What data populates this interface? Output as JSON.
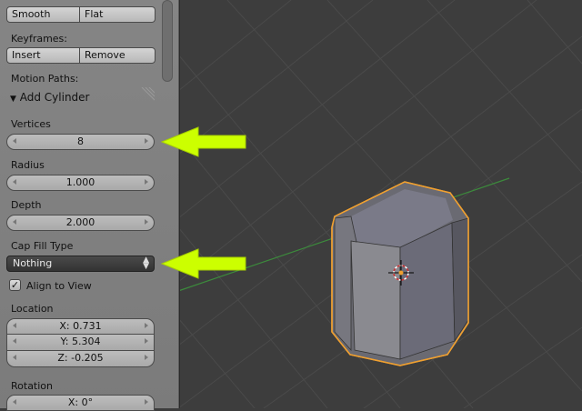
{
  "panel": {
    "shading": {
      "smooth_label": "Smooth",
      "flat_label": "Flat"
    },
    "keyframes": {
      "label": "Keyframes:",
      "insert_label": "Insert",
      "remove_label": "Remove"
    },
    "motion_paths_label": "Motion Paths:",
    "operator_title": "Add Cylinder",
    "vertices": {
      "label": "Vertices",
      "value": "8"
    },
    "radius": {
      "label": "Radius",
      "value": "1.000"
    },
    "depth": {
      "label": "Depth",
      "value": "2.000"
    },
    "cap_fill": {
      "label": "Cap Fill Type",
      "value": "Nothing"
    },
    "align_to_view": {
      "label": "Align to View",
      "checked": true
    },
    "location": {
      "label": "Location",
      "x": "X: 0.731",
      "y": "Y: 5.304",
      "z": "Z: -0.205"
    },
    "rotation": {
      "label": "Rotation",
      "x": "X: 0°"
    }
  },
  "annotations": {
    "arrow_color": "#ccff00"
  },
  "viewport": {
    "background": "#3d3d3d",
    "grid_color": "#4a4a4a",
    "x_axis_color": "#3c8a3c",
    "selection_outline": "#f0a030"
  }
}
